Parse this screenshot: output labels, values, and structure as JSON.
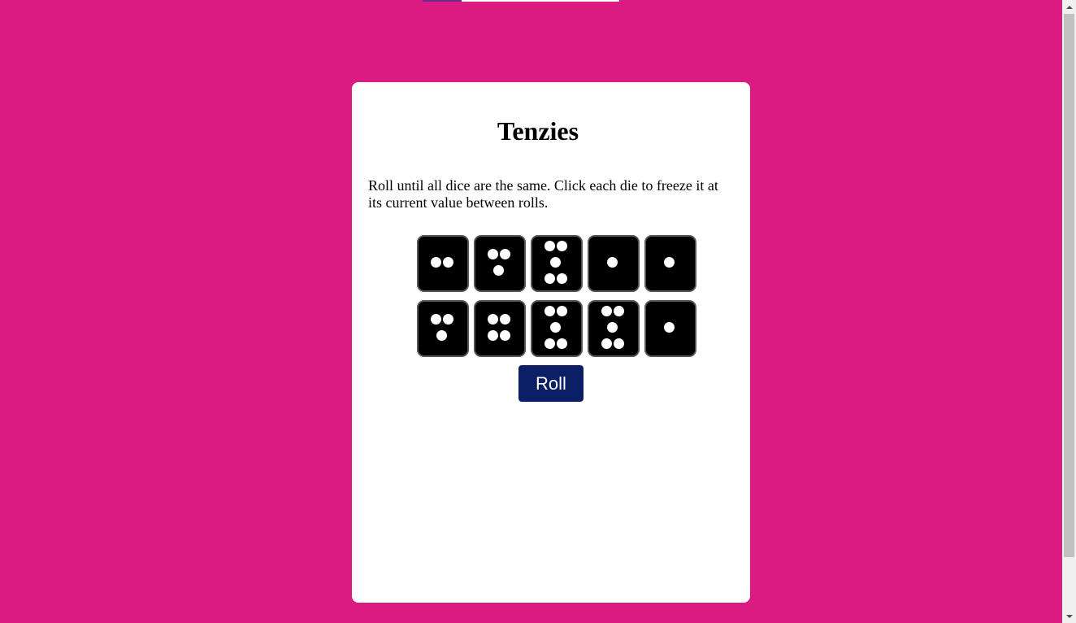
{
  "game": {
    "title": "Tenzies",
    "instructions": "Roll until all dice are the same. Click each die to freeze it at its current value between rolls.",
    "roll_label": "Roll"
  },
  "dice": [
    {
      "value": 2,
      "held": false
    },
    {
      "value": 3,
      "held": false
    },
    {
      "value": 5,
      "held": false
    },
    {
      "value": 1,
      "held": false
    },
    {
      "value": 1,
      "held": false
    },
    {
      "value": 3,
      "held": false
    },
    {
      "value": 4,
      "held": false
    },
    {
      "value": 5,
      "held": false
    },
    {
      "value": 5,
      "held": false
    },
    {
      "value": 1,
      "held": false
    }
  ],
  "colors": {
    "page_background": "#db1a82",
    "card_background": "#ffffff",
    "die_face": "#000000",
    "pip": "#ffffff",
    "roll_button": "#0b1f66"
  }
}
